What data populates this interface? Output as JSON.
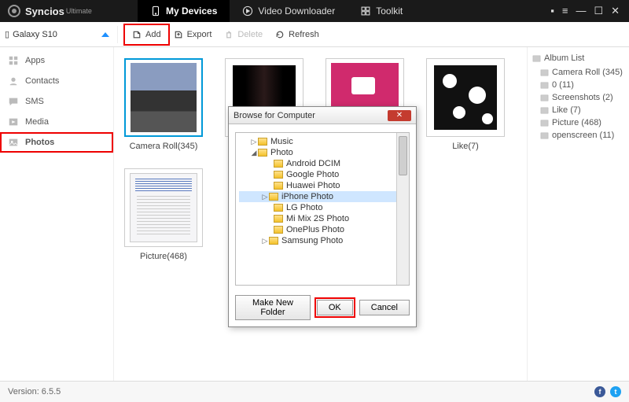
{
  "app": {
    "name": "Syncios",
    "edition": "Ultimate"
  },
  "nav": {
    "devices": "My Devices",
    "video": "Video Downloader",
    "toolkit": "Toolkit"
  },
  "device": {
    "name": "Galaxy S10"
  },
  "toolbar": {
    "add": "Add",
    "export": "Export",
    "delete": "Delete",
    "refresh": "Refresh"
  },
  "sidebar": {
    "apps": "Apps",
    "contacts": "Contacts",
    "sms": "SMS",
    "media": "Media",
    "photos": "Photos"
  },
  "albums": {
    "camera": "Camera Roll(345)",
    "zero": "0(11)",
    "screenshots": "Screenshots(2)",
    "like": "Like(7)",
    "picture": "Picture(468)"
  },
  "rightpanel": {
    "title": "Album List",
    "items": {
      "camera": "Camera Roll (345)",
      "zero": "0 (11)",
      "screenshots": "Screenshots (2)",
      "like": "Like (7)",
      "picture": "Picture (468)",
      "openscreen": "openscreen (11)"
    }
  },
  "dialog": {
    "title": "Browse for Computer",
    "tree": {
      "music": "Music",
      "photo": "Photo",
      "android": "Android DCIM",
      "google": "Google Photo",
      "huawei": "Huawei Photo",
      "iphone": "iPhone Photo",
      "lg": "LG Photo",
      "mimix": "Mi Mix 2S Photo",
      "oneplus": "OnePlus Photo",
      "samsung": "Samsung Photo"
    },
    "buttons": {
      "new": "Make New Folder",
      "ok": "OK",
      "cancel": "Cancel"
    }
  },
  "footer": {
    "version": "Version: 6.5.5"
  }
}
